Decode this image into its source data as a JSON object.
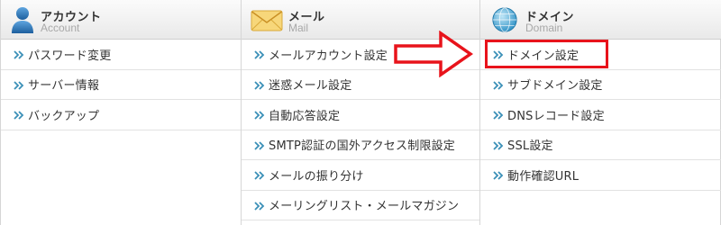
{
  "columns": {
    "account": {
      "title_ja": "アカウント",
      "title_en": "Account",
      "icon": "user-icon",
      "items": [
        {
          "label": "パスワード変更"
        },
        {
          "label": "サーバー情報"
        },
        {
          "label": "バックアップ"
        }
      ]
    },
    "mail": {
      "title_ja": "メール",
      "title_en": "Mail",
      "icon": "envelope-icon",
      "items": [
        {
          "label": "メールアカウント設定"
        },
        {
          "label": "迷惑メール設定"
        },
        {
          "label": "自動応答設定"
        },
        {
          "label": "SMTP認証の国外アクセス制限設定"
        },
        {
          "label": "メールの振り分け"
        },
        {
          "label": "メーリングリスト・メールマガジン"
        }
      ]
    },
    "domain": {
      "title_ja": "ドメイン",
      "title_en": "Domain",
      "icon": "globe-icon",
      "items": [
        {
          "label": "ドメイン設定",
          "highlighted": true
        },
        {
          "label": "サブドメイン設定"
        },
        {
          "label": "DNSレコード設定"
        },
        {
          "label": "SSL設定"
        },
        {
          "label": "動作確認URL"
        }
      ]
    }
  },
  "annotation": {
    "arrow_target": "ドメイン設定",
    "color": "#e8131b"
  },
  "colors": {
    "link_arrow": "#3a8fb7",
    "text": "#333333",
    "subtitle": "#a8a8a8"
  }
}
